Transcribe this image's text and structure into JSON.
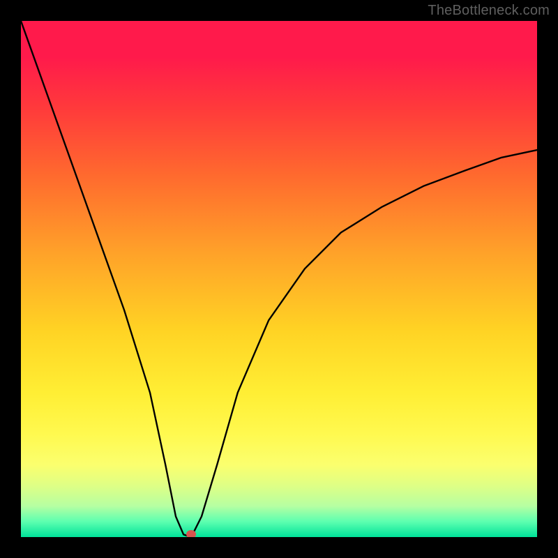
{
  "watermark": "TheBottleneck.com",
  "chart_data": {
    "type": "line",
    "title": "",
    "xlabel": "",
    "ylabel": "",
    "xlim": [
      0,
      100
    ],
    "ylim": [
      0,
      100
    ],
    "series": [
      {
        "name": "curve",
        "x": [
          0,
          5,
          10,
          15,
          20,
          25,
          28,
          30,
          31.5,
          33,
          35,
          38,
          42,
          48,
          55,
          62,
          70,
          78,
          86,
          93,
          100
        ],
        "values": [
          100,
          86,
          72,
          58,
          44,
          28,
          14,
          4,
          0.5,
          0,
          4,
          14,
          28,
          42,
          52,
          59,
          64,
          68,
          71,
          73.5,
          75
        ]
      }
    ],
    "marker": {
      "x": 33,
      "y": 0.5
    },
    "gradient_colors": {
      "top": "#ff1a4b",
      "mid_upper": "#ffa229",
      "mid": "#ffee34",
      "bottom": "#00e39a"
    },
    "background": "#000000"
  }
}
